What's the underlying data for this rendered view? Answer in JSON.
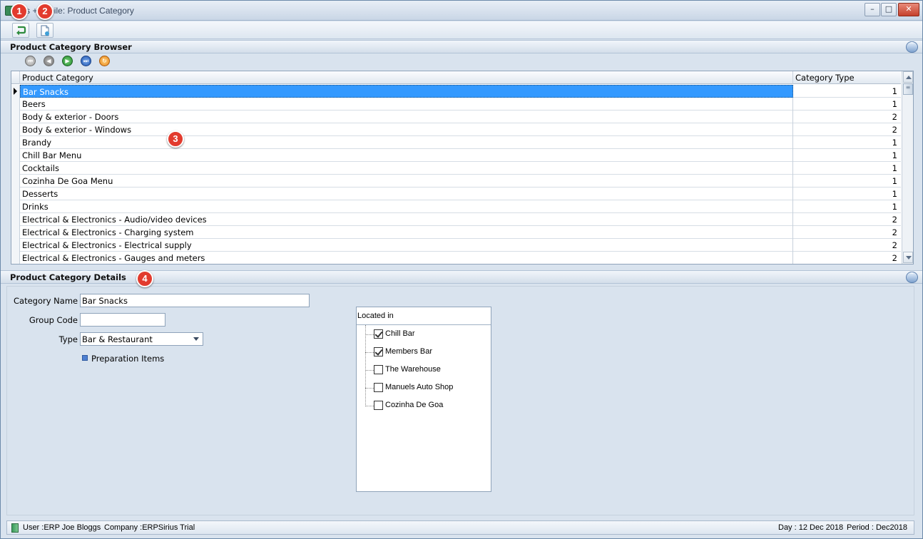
{
  "window": {
    "title": "P         s +Mobile: Product Category",
    "controls": {
      "minimize": "–",
      "maximize": "□",
      "close": "✕"
    }
  },
  "annotations": [
    "1",
    "2",
    "3",
    "4"
  ],
  "toolbar": {
    "buttons": [
      {
        "icon": "green-return-arrow-icon"
      },
      {
        "icon": "new-document-icon"
      }
    ]
  },
  "browser": {
    "title": "Product Category Browser",
    "nav_buttons": [
      "first",
      "previous",
      "next",
      "last",
      "refresh"
    ],
    "columns": [
      "Product Category",
      "Category Type"
    ],
    "rows": [
      {
        "name": "Bar Snacks",
        "type": "1"
      },
      {
        "name": "Beers",
        "type": "1"
      },
      {
        "name": "Body & exterior - Doors",
        "type": "2"
      },
      {
        "name": "Body & exterior - Windows",
        "type": "2"
      },
      {
        "name": "Brandy",
        "type": "1"
      },
      {
        "name": "Chill Bar Menu",
        "type": "1"
      },
      {
        "name": "Cocktails",
        "type": "1"
      },
      {
        "name": "Cozinha De Goa Menu",
        "type": "1"
      },
      {
        "name": "Desserts",
        "type": "1"
      },
      {
        "name": "Drinks",
        "type": "1"
      },
      {
        "name": "Electrical & Electronics - Audio/video devices",
        "type": "2"
      },
      {
        "name": "Electrical & Electronics - Charging system",
        "type": "2"
      },
      {
        "name": "Electrical & Electronics - Electrical supply",
        "type": "2"
      },
      {
        "name": "Electrical & Electronics - Gauges and meters",
        "type": "2"
      }
    ],
    "selected_index": 0
  },
  "details": {
    "title": "Product Category Details",
    "category_name_label": "Category Name",
    "category_name_value": "Bar Snacks",
    "group_code_label": "Group Code",
    "group_code_value": "",
    "type_label": "Type",
    "type_value": "Bar & Restaurant",
    "preparation_items_label": "Preparation Items",
    "located_in": {
      "title": "Located in",
      "items": [
        {
          "label": "Chill Bar",
          "checked": true
        },
        {
          "label": "Members Bar",
          "checked": true
        },
        {
          "label": "The Warehouse",
          "checked": false
        },
        {
          "label": "Manuels Auto Shop",
          "checked": false
        },
        {
          "label": "Cozinha De Goa",
          "checked": false
        }
      ]
    }
  },
  "status": {
    "user": "User :ERP Joe Bloggs",
    "company": "Company :ERPSirius Trial",
    "day": "Day : 12 Dec 2018",
    "period": "Period : Dec2018"
  },
  "colors": {
    "selection": "#3399ff",
    "badge": "#e23b2e"
  }
}
